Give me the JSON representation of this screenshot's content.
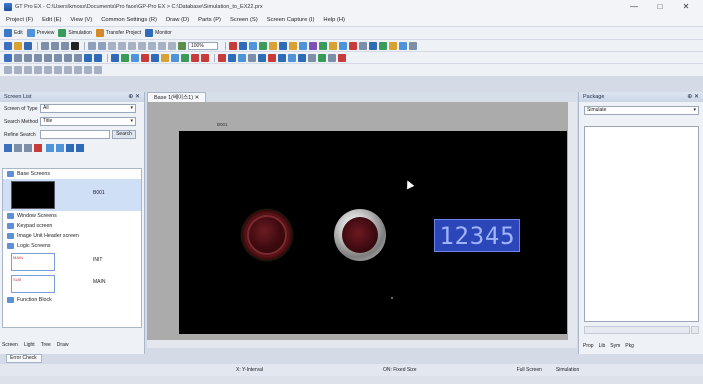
{
  "window": {
    "title": "GT Pro EX - C:\\Users\\kmoss\\Documents\\Pro face\\GP-Pro EX > C:\\Database\\Simulation_to_EX22.prx"
  },
  "window_controls": [
    "—",
    "□",
    "✕"
  ],
  "menu": [
    "Project (F)",
    "Edit (E)",
    "View (V)",
    "Common Settings (R)",
    "Draw (D)",
    "Parts (P)",
    "Screen (S)",
    "Screen Capture (I)",
    "Help (H)"
  ],
  "toolbar1": {
    "items": [
      "Edit",
      "Preview",
      "Simulation",
      "Transfer Project",
      "Monitor"
    ]
  },
  "toolbar2": {
    "zoom": "100%"
  },
  "left_panel": {
    "header": "Screen List",
    "fields": [
      {
        "label": "Screen of Type",
        "value": "All"
      },
      {
        "label": "Search Method",
        "value": "Title"
      },
      {
        "label": "Refine Search",
        "value": "",
        "button": "Search"
      }
    ],
    "tree": {
      "base_screens": "Base Screens",
      "base_item_label": "B001",
      "window_screens": "Window Screens",
      "keypad_screen": "Keypad screen",
      "image_unit": "Image Unit Header screen",
      "logic_screens": "Logic Screens",
      "logic_items": [
        {
          "tag": "MAIN",
          "label": "INIT"
        },
        {
          "tag": "SUB",
          "label": "MAIN"
        }
      ],
      "function_block": "Function Block"
    },
    "tabs": [
      "Screen",
      "Light",
      "Tree",
      "Draw"
    ]
  },
  "doc_tab": {
    "label": "Base 1(베이스1)",
    "close": "✕"
  },
  "canvas": {
    "counter_digits": [
      "1",
      "2",
      "3",
      "4",
      "5"
    ],
    "marker": "B001"
  },
  "right_panel": {
    "header": "Package",
    "dropdown": "Simulate",
    "tabs": [
      "Prop",
      "Lib",
      "Sym",
      "Pkg"
    ]
  },
  "error_tab": "Error Check",
  "status": [
    "X: Y-Interval",
    "ON: Fixed Size",
    "Full Screen",
    "Simulation"
  ],
  "colors": {
    "counter_bg": "#2a46b8",
    "counter_digit": "#9fb4ff",
    "canvas_bg": "#000000",
    "workspace_bg": "#ababab",
    "lamp_red": "#6b1c23"
  }
}
